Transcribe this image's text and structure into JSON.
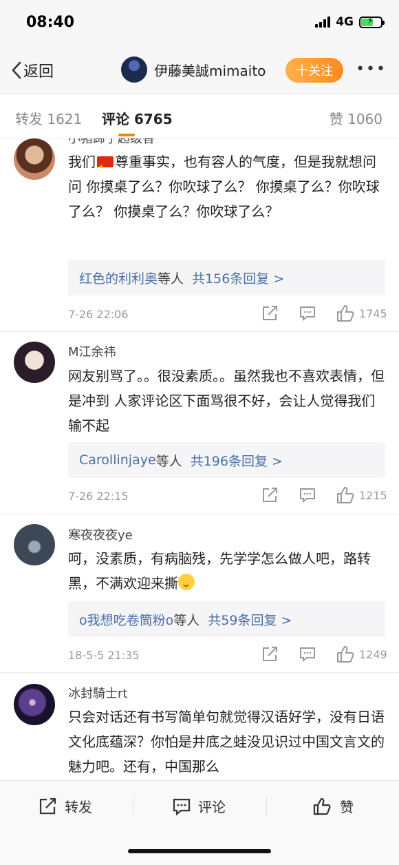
{
  "status": {
    "time": "08:40",
    "network": "4G"
  },
  "nav": {
    "back_label": "返回",
    "user_name": "伊藤美誠mimaito",
    "follow_label": "十关注",
    "more_label": "•••"
  },
  "tabs": [
    {
      "label": "转发 1621"
    },
    {
      "label": "评论 6765"
    },
    {
      "label": "赞 1060"
    }
  ],
  "comments": [
    {
      "user": "小猪蹄子超级香",
      "text_before_flag": "我们",
      "text_after_flag": "尊重事实，也有容人的气度，但是我就想问问 你摸桌了么？你吹球了么？ 你摸桌了么？你吹球了么？ 你摸桌了么？你吹球了么？",
      "reply_who": "红色的利利奥",
      "reply_etc": "等人",
      "reply_count": "共156条回复 >",
      "time": "7-26 22:06",
      "likes": "1745"
    },
    {
      "user": "M江余祎",
      "text": "网友别骂了。。很没素质。。虽然我也不喜欢表情，但是冲到 人家评论区下面骂很不好，会让人觉得我们输不起",
      "reply_who": "Carollinjaye",
      "reply_etc": "等人",
      "reply_count": "共196条回复 >",
      "time": "7-26 22:15",
      "likes": "1215"
    },
    {
      "user": "寒夜夜夜ye",
      "text": "呵，没素质，有病脑残，先学学怎么做人吧，路转黑，不满欢迎来撕",
      "reply_who": "o我想吃卷筒粉o",
      "reply_etc": "等人",
      "reply_count": "共59条回复 >",
      "time": "18-5-5 21:35",
      "likes": "1249"
    },
    {
      "user": "冰封騎士rt",
      "text": "只会对话还有书写简单句就觉得汉语好学，没有日语文化底蕴深？你怕是井底之蛙没见识过中国文言文的魅力吧。还有，中国那么"
    }
  ],
  "bottom_bar": {
    "repost_label": "转发",
    "comment_label": "评论",
    "like_label": "赞"
  },
  "colors": {
    "accent": "#ff8200",
    "link": "#4a6fa5",
    "follow_gradient_start": "#ffb14b",
    "follow_gradient_end": "#ff8a1e"
  },
  "icons": [
    "back-chevron-icon",
    "share-icon",
    "comment-icon",
    "thumbs-up-icon",
    "signal-icon",
    "battery-icon"
  ]
}
